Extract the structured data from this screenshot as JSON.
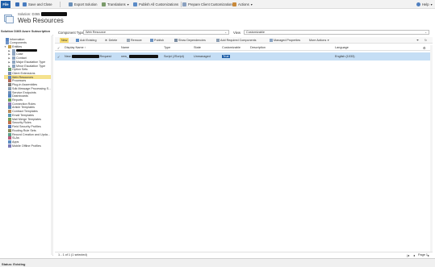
{
  "ribbon": {
    "file_label": "File",
    "buttons": [
      {
        "label": "Save and Close",
        "icon": "save-close-icon"
      },
      {
        "label": "Export Solution",
        "icon": "export-icon"
      },
      {
        "label": "Translations",
        "icon": "translations-icon"
      },
      {
        "label": "Publish All Customizations",
        "icon": "publish-all-icon"
      },
      {
        "label": "Prepare Client Customizations",
        "icon": "prepare-client-icon"
      },
      {
        "label": "Actions",
        "icon": "actions-icon"
      }
    ],
    "help_label": "Help"
  },
  "header": {
    "solution_prefix": "Solution: D365",
    "title": "Web Resources",
    "solution_name_label": "Solution D365 Azure Subscription"
  },
  "sidebar": {
    "items": [
      {
        "label": "Information",
        "level": 0,
        "expander": "",
        "selected": false,
        "icon": "info-icon"
      },
      {
        "label": "Components",
        "level": 0,
        "expander": "",
        "selected": false,
        "icon": "components-icon"
      },
      {
        "label": "Entities",
        "level": 1,
        "expander": "▼",
        "selected": false,
        "icon": "entities-icon"
      },
      {
        "label": "",
        "level": 2,
        "expander": "▶",
        "selected": false,
        "icon": "entity-icon"
      },
      {
        "label": "Case",
        "level": 2,
        "expander": "▶",
        "selected": false,
        "icon": "entity-icon"
      },
      {
        "label": "Contact",
        "level": 2,
        "expander": "▶",
        "selected": false,
        "icon": "entity-icon"
      },
      {
        "label": "Major Escalation Type",
        "level": 2,
        "expander": "▶",
        "selected": false,
        "icon": "entity-icon"
      },
      {
        "label": "Minor Escalation Type",
        "level": 2,
        "expander": "▶",
        "selected": false,
        "icon": "entity-icon"
      },
      {
        "label": "Option Sets",
        "level": 1,
        "expander": "",
        "selected": false,
        "icon": "option-sets-icon"
      },
      {
        "label": "Client Extensions",
        "level": 1,
        "expander": "",
        "selected": false,
        "icon": "client-extensions-icon"
      },
      {
        "label": "Web Resources",
        "level": 1,
        "expander": "",
        "selected": true,
        "icon": "web-resources-icon"
      },
      {
        "label": "Processes",
        "level": 1,
        "expander": "",
        "selected": false,
        "icon": "processes-icon"
      },
      {
        "label": "Plug-in Assemblies",
        "level": 1,
        "expander": "",
        "selected": false,
        "icon": "plugin-assemblies-icon"
      },
      {
        "label": "Sdk Message Processing S...",
        "level": 1,
        "expander": "",
        "selected": false,
        "icon": "sdk-message-icon"
      },
      {
        "label": "Service Endpoints",
        "level": 1,
        "expander": "",
        "selected": false,
        "icon": "service-endpoints-icon"
      },
      {
        "label": "Dashboards",
        "level": 1,
        "expander": "",
        "selected": false,
        "icon": "dashboards-icon"
      },
      {
        "label": "Reports",
        "level": 1,
        "expander": "",
        "selected": false,
        "icon": "reports-icon"
      },
      {
        "label": "Connection Roles",
        "level": 1,
        "expander": "",
        "selected": false,
        "icon": "connection-roles-icon"
      },
      {
        "label": "Article Templates",
        "level": 1,
        "expander": "",
        "selected": false,
        "icon": "article-templates-icon"
      },
      {
        "label": "Contract Templates",
        "level": 1,
        "expander": "",
        "selected": false,
        "icon": "contract-templates-icon"
      },
      {
        "label": "Email Templates",
        "level": 1,
        "expander": "",
        "selected": false,
        "icon": "email-templates-icon"
      },
      {
        "label": "Mail Merge Templates",
        "level": 1,
        "expander": "",
        "selected": false,
        "icon": "mail-merge-icon"
      },
      {
        "label": "Security Roles",
        "level": 1,
        "expander": "",
        "selected": false,
        "icon": "security-roles-icon"
      },
      {
        "label": "Field Security Profiles",
        "level": 1,
        "expander": "",
        "selected": false,
        "icon": "field-security-icon"
      },
      {
        "label": "Routing Rule Sets",
        "level": 1,
        "expander": "",
        "selected": false,
        "icon": "routing-rules-icon"
      },
      {
        "label": "Record Creation and Upda...",
        "level": 1,
        "expander": "",
        "selected": false,
        "icon": "record-creation-icon"
      },
      {
        "label": "SLAs",
        "level": 1,
        "expander": "",
        "selected": false,
        "icon": "slas-icon"
      },
      {
        "label": "Apps",
        "level": 1,
        "expander": "",
        "selected": false,
        "icon": "apps-icon"
      },
      {
        "label": "Mobile Offline Profiles",
        "level": 1,
        "expander": "",
        "selected": false,
        "icon": "mobile-offline-icon"
      }
    ]
  },
  "filters": {
    "component_type_label": "Component Type",
    "component_type_value": "Web Resource",
    "view_label": "View",
    "view_value": "Customizable"
  },
  "toolbar": {
    "new_label": "New",
    "add_existing_label": "Add Existing",
    "delete_label": "Delete",
    "remove_label": "Remove",
    "publish_label": "Publish",
    "show_dependencies_label": "Show Dependencies",
    "add_required_label": "Add Required Components",
    "managed_properties_label": "Managed Properties",
    "more_actions_label": "More Actions"
  },
  "grid": {
    "columns": [
      "Display Name",
      "Name",
      "Type",
      "State",
      "Customizable",
      "Description",
      "Language"
    ],
    "rows": [
      {
        "display_name_prefix": "New",
        "display_name_suffix": "Request",
        "name_prefix": "new_",
        "type": "Script (JScript)",
        "state": "Unmanaged",
        "customizable": "True",
        "description": "",
        "language": "English (1033)"
      }
    ],
    "selection_summary": "1 - 1 of 1 (1 selected)",
    "page_label": "Page 1"
  },
  "status": {
    "text": "Status: Existing"
  },
  "colors": {
    "file_button": "#1f5fa8",
    "selected_row": "#c5def5",
    "selected_nav": "#f5e28e",
    "new_button": "#f7dc6f"
  }
}
